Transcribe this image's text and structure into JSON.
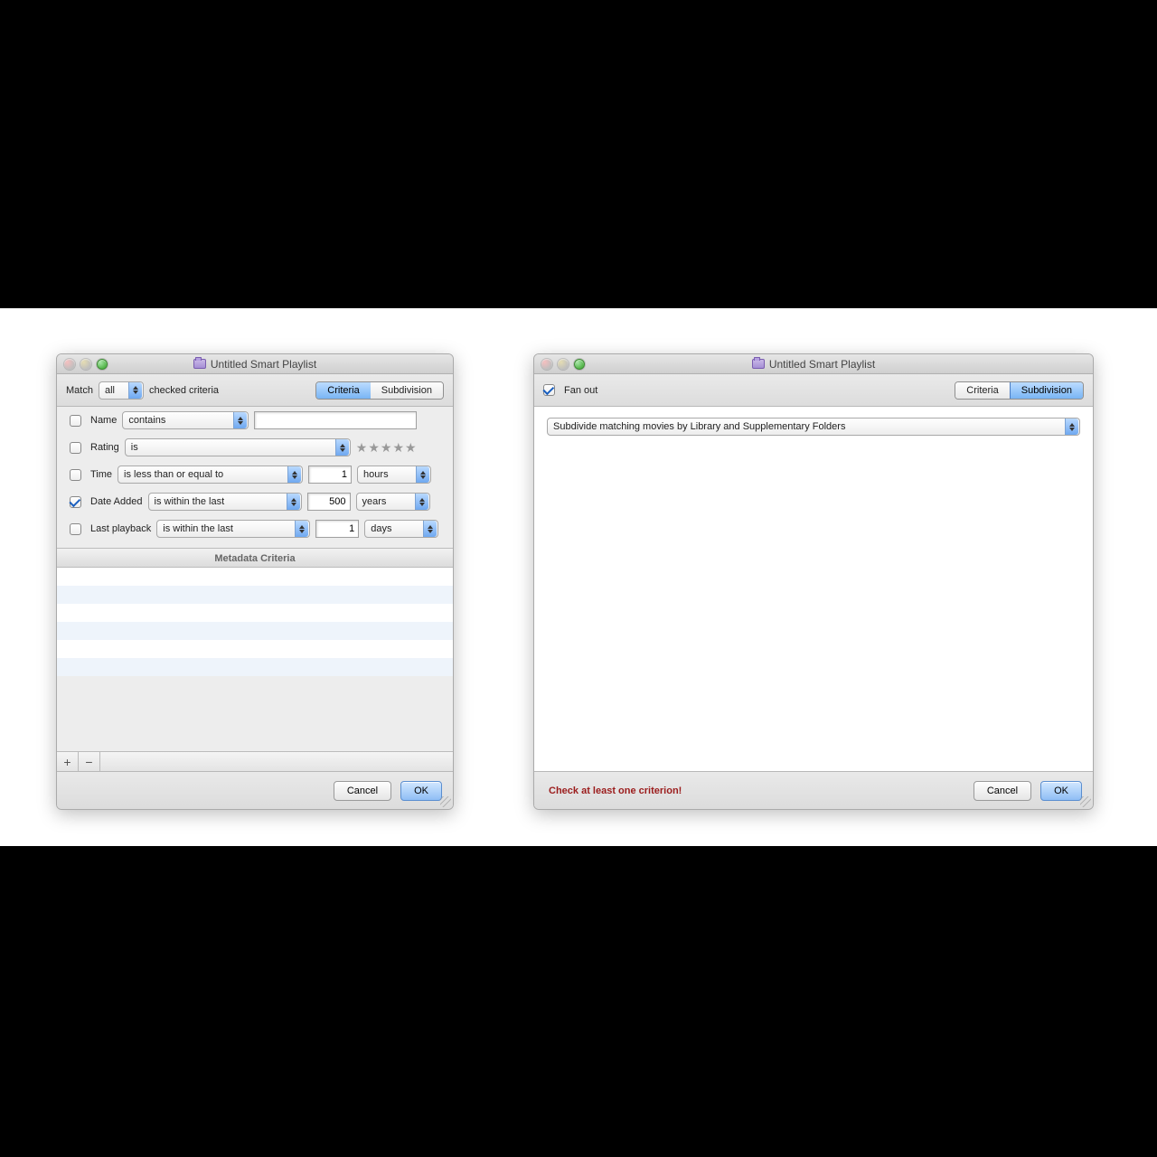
{
  "left_window": {
    "title": "Untitled Smart Playlist",
    "toolbar": {
      "match_label": "Match",
      "match_value": "all",
      "match_suffix": "checked criteria",
      "segments": {
        "criteria": "Criteria",
        "subdivision": "Subdivision"
      },
      "active_segment": "criteria"
    },
    "rules": {
      "name": {
        "label": "Name",
        "checked": false,
        "op": "contains",
        "value": ""
      },
      "rating": {
        "label": "Rating",
        "checked": false,
        "op": "is",
        "stars": 0
      },
      "time": {
        "label": "Time",
        "checked": false,
        "op": "is less than or equal to",
        "value": "1",
        "unit": "hours"
      },
      "date_added": {
        "label": "Date Added",
        "checked": true,
        "op": "is within the last",
        "value": "500",
        "unit": "years"
      },
      "last_play": {
        "label": "Last playback",
        "checked": false,
        "op": "is within the last",
        "value": "1",
        "unit": "days"
      }
    },
    "metadata_header": "Metadata Criteria",
    "add_label": "+",
    "remove_label": "−",
    "footer": {
      "cancel": "Cancel",
      "ok": "OK"
    }
  },
  "right_window": {
    "title": "Untitled Smart Playlist",
    "toolbar": {
      "fanout_label": "Fan out",
      "fanout_checked": true,
      "segments": {
        "criteria": "Criteria",
        "subdivision": "Subdivision"
      },
      "active_segment": "subdivision"
    },
    "subdivide_value": "Subdivide matching movies by Library and Supplementary Folders",
    "footer": {
      "warning": "Check at least one criterion!",
      "cancel": "Cancel",
      "ok": "OK"
    }
  }
}
